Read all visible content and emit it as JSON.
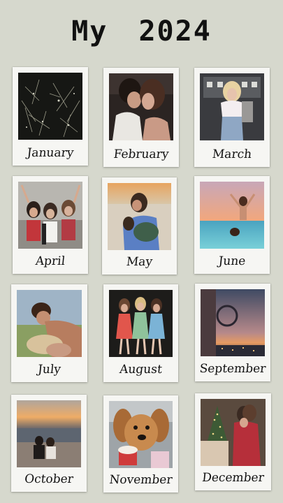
{
  "title": "My 2024",
  "months": [
    {
      "label": "January"
    },
    {
      "label": "February"
    },
    {
      "label": "March"
    },
    {
      "label": "April"
    },
    {
      "label": "May"
    },
    {
      "label": "June"
    },
    {
      "label": "July"
    },
    {
      "label": "August"
    },
    {
      "label": "September"
    },
    {
      "label": "October"
    },
    {
      "label": "November"
    },
    {
      "label": "December"
    }
  ]
}
